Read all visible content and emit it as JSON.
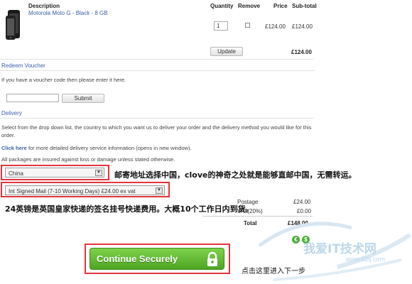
{
  "cart": {
    "headers": {
      "description": "Description",
      "quantity": "Quantity",
      "remove": "Remove",
      "price": "Price",
      "subtotal": "Sub-total"
    },
    "item": {
      "name": "Motorola Moto G - Black - 8 GB",
      "quantity": "1",
      "price": "£124.00",
      "subtotal": "£124.00"
    },
    "update_label": "Update",
    "cart_total": "£124.00"
  },
  "voucher": {
    "heading": "Redeem Voucher",
    "text": "If you have a voucher code then please enter it here.",
    "input_value": "",
    "submit_label": "Submit"
  },
  "delivery": {
    "heading": "Delivery",
    "text": "Select from the drop down list, the country to which you want us to deliver your order and the delivery method you would like for this order.",
    "click_here": "Click here",
    "info_text": " for more detailed delivery service information (opens in new window).",
    "insured_text": "All packages are insured against loss or damage unless stated otherwise.",
    "country": "China",
    "method": "Int Signed Mail (7-10 Working Days) £24.00 ex vat"
  },
  "totals": {
    "postage_label": "Postage",
    "postage_value": "£24.00",
    "vat_label": "VAT(20%)",
    "vat_value": "£0.00",
    "total_label": "Total",
    "total_value": "£148.00"
  },
  "continue_label": "Continue Securely",
  "annotations": {
    "country_note": "邮寄地址选择中国，clove的神奇之处就是能够直邮中国，无需转运。",
    "method_note": "24英镑是英国皇家快递的签名挂号快递费用。大概10个工作日内到货。",
    "continue_note": "点击这里进入下一步"
  },
  "watermark": {
    "title": "我爱IT技术网",
    "url": "www.52ij.com"
  },
  "colors": {
    "link": "#3a5fa8",
    "annotation_border": "#e4343c",
    "continue_green": "#5cb82c"
  }
}
